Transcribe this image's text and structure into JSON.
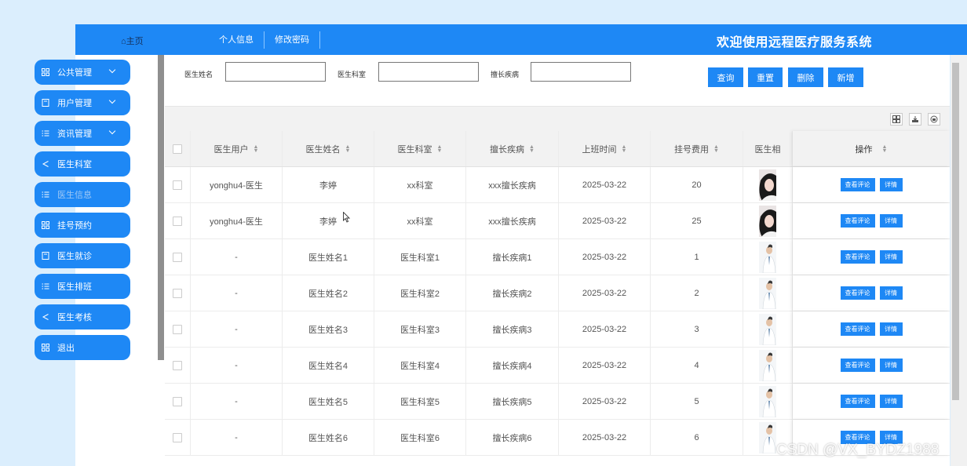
{
  "topbar": {
    "home": "⌂主页",
    "nav": [
      "个人信息",
      "修改密码"
    ],
    "title": "欢迎使用远程医疗服务系统"
  },
  "sidebar": {
    "items": [
      {
        "label": "公共管理",
        "icon": "grid-icon",
        "expandable": true
      },
      {
        "label": "用户管理",
        "icon": "book-icon",
        "expandable": true
      },
      {
        "label": "资讯管理",
        "icon": "list-icon",
        "expandable": true
      },
      {
        "label": "医生科室",
        "icon": "share-icon",
        "expandable": false
      },
      {
        "label": "医生信息",
        "icon": "list-icon",
        "expandable": false,
        "disabled": true
      },
      {
        "label": "挂号预约",
        "icon": "grid-icon",
        "expandable": false
      },
      {
        "label": "医生就诊",
        "icon": "book-icon",
        "expandable": false
      },
      {
        "label": "医生排班",
        "icon": "list-icon",
        "expandable": false
      },
      {
        "label": "医生考核",
        "icon": "share-icon",
        "expandable": false
      },
      {
        "label": "退出",
        "icon": "grid-icon",
        "expandable": false
      }
    ]
  },
  "search": {
    "fields": [
      {
        "label": "医生姓名",
        "value": ""
      },
      {
        "label": "医生科室",
        "value": ""
      },
      {
        "label": "擅长疾病",
        "value": ""
      }
    ],
    "buttons": [
      "查询",
      "重置",
      "删除",
      "新增"
    ]
  },
  "table": {
    "columns": [
      "医生用户",
      "医生姓名",
      "医生科室",
      "擅长疾病",
      "上班时间",
      "挂号费用",
      "医生相",
      "操作"
    ],
    "rows": [
      {
        "user": "yonghu4-医生",
        "name": "李婷",
        "dept": "xx科室",
        "disease": "xxx擅长疾病",
        "time": "2025-03-22",
        "fee": "20"
      },
      {
        "user": "yonghu4-医生",
        "name": "李婷",
        "dept": "xx科室",
        "disease": "xxx擅长疾病",
        "time": "2025-03-22",
        "fee": "25"
      },
      {
        "user": "-",
        "name": "医生姓名1",
        "dept": "医生科室1",
        "disease": "擅长疾病1",
        "time": "2025-03-22",
        "fee": "1"
      },
      {
        "user": "-",
        "name": "医生姓名2",
        "dept": "医生科室2",
        "disease": "擅长疾病2",
        "time": "2025-03-22",
        "fee": "2"
      },
      {
        "user": "-",
        "name": "医生姓名3",
        "dept": "医生科室3",
        "disease": "擅长疾病3",
        "time": "2025-03-22",
        "fee": "3"
      },
      {
        "user": "-",
        "name": "医生姓名4",
        "dept": "医生科室4",
        "disease": "擅长疾病4",
        "time": "2025-03-22",
        "fee": "4"
      },
      {
        "user": "-",
        "name": "医生姓名5",
        "dept": "医生科室5",
        "disease": "擅长疾病5",
        "time": "2025-03-22",
        "fee": "5"
      },
      {
        "user": "-",
        "name": "医生姓名6",
        "dept": "医生科室6",
        "disease": "擅长疾病6",
        "time": "2025-03-22",
        "fee": "6"
      }
    ],
    "row_actions": [
      "查看评论",
      "详情"
    ]
  },
  "watermark": "CSDN @VX_BYDZ1988",
  "colors": {
    "primary": "#1e88f5",
    "page_bg": "#dbeefd"
  }
}
